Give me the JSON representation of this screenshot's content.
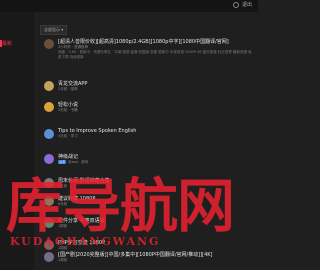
{
  "header": {
    "user_label": "退出"
  },
  "sidebar": {
    "active_label": "最新"
  },
  "filter": {
    "label": "全部显示 ▾"
  },
  "items": [
    {
      "title": "[超清人音限价收][超高清]1080p/2.4GB][1080p中字][1080中国翻译/官网]",
      "meta": "3小时前 · 资源推荐",
      "desc": "收藏 · 3.8K · 更新中 · 资源分享区 · 字幕·国语·高清·完整版·多集·更新中·中英双语·1080P·4K·蓝光原盘·杜比视界·最新资源·免费下载·持续更新",
      "color": "#6b4f3a",
      "desc_lines": 3
    },
    {
      "title": "青龙交流APP",
      "meta": "2天前 · 推荐",
      "color": "#c9a25a"
    },
    {
      "title": "轻松小说",
      "meta": "3天前 · 书籍",
      "color": "#d9a53a"
    },
    {
      "title": "Tips to Improve Spoken English",
      "meta": "4天前 · 学习",
      "color": "#5b8fd6"
    },
    {
      "title": "神级战记",
      "meta": "@asd · 游戏",
      "color": "#8a6bd6",
      "badge": "资源"
    },
    {
      "title": "周末休闲 影视推荐合集",
      "meta": "5天前",
      "color": "#7a7a7a"
    },
    {
      "title": "建议收藏 1080P",
      "meta": "6天前",
      "color": "#8a7a5a"
    },
    {
      "title": "软件分享 中英双语版",
      "meta": "1周前",
      "color": "#5a8a6a"
    },
    {
      "title": "PHP学习交流 1080P",
      "meta": "1周前",
      "color": "#8a5a5a"
    },
    {
      "title": "[国产剧]2020完整版][中国/多集中][1080P中国翻译/官网/推动]][4K]",
      "meta": "1周前",
      "color": "#7a6a8a"
    }
  ],
  "watermark": {
    "text": "库导航网",
    "sub": "KUDAOHANGWANG"
  }
}
